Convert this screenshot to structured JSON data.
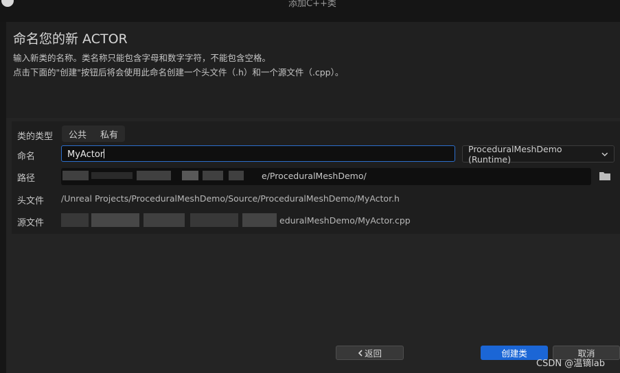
{
  "window": {
    "title": "添加C++类"
  },
  "header": {
    "title": "命名您的新 ACTOR",
    "line1": "输入新类的名称。类名称只能包含字母和数字字符，不能包含空格。",
    "line2": "点击下面的\"创建\"按钮后将会使用此命名创建一个头文件（.h）和一个源文件（.cpp）。"
  },
  "form": {
    "class_type_label": "类的类型",
    "class_type_options": [
      "公共",
      "私有"
    ],
    "name_label": "命名",
    "name_value": "MyActor",
    "module_value": "ProceduralMeshDemo (Runtime)",
    "path_label": "路径",
    "path_value": "e/ProceduralMeshDemo/",
    "header_label": "头文件",
    "header_value": "/Unreal Projects/ProceduralMeshDemo/Source/ProceduralMeshDemo/MyActor.h",
    "source_label": "源文件",
    "source_value": "eduralMeshDemo/MyActor.cpp"
  },
  "buttons": {
    "back": "返回",
    "create": "创建类",
    "cancel": "取消"
  },
  "watermark": "CSDN @温镝lab"
}
